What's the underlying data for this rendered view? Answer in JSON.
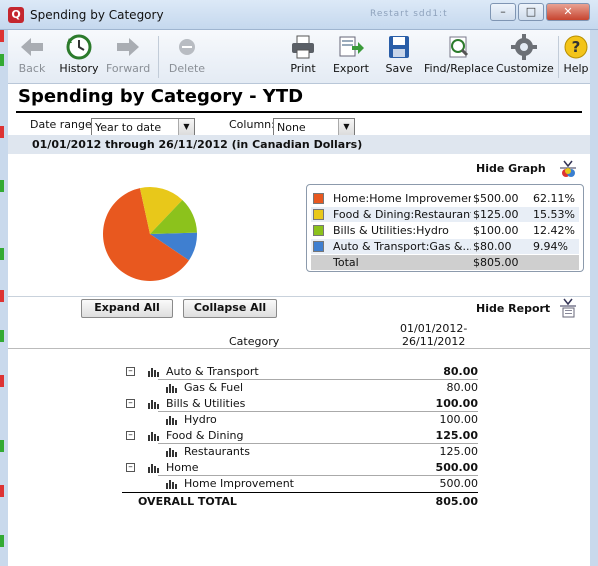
{
  "window": {
    "title": "Spending by Category",
    "icon_letter": "Q",
    "ghost_text": "Restart  sdd1:t"
  },
  "toolbar": {
    "items": [
      {
        "label": "Back",
        "icon": "back-arrow-icon",
        "enabled": false
      },
      {
        "label": "History",
        "icon": "history-clock-icon",
        "enabled": true
      },
      {
        "label": "Forward",
        "icon": "forward-arrow-icon",
        "enabled": false
      },
      {
        "label": "Delete",
        "icon": "delete-icon",
        "enabled": false
      },
      {
        "label": "Print",
        "icon": "printer-icon",
        "enabled": true
      },
      {
        "label": "Export",
        "icon": "export-icon",
        "enabled": true
      },
      {
        "label": "Save",
        "icon": "floppy-disk-icon",
        "enabled": true
      },
      {
        "label": "Find/Replace",
        "icon": "find-replace-icon",
        "enabled": true
      },
      {
        "label": "Customize",
        "icon": "gear-icon",
        "enabled": true
      },
      {
        "label": "Help",
        "icon": "help-icon",
        "enabled": true
      }
    ]
  },
  "report": {
    "title": "Spending by Category - YTD",
    "date_range_label": "Date range:",
    "date_range_value": "Year to date",
    "column_label": "Column:",
    "column_value": "None",
    "period_text": "01/01/2012 through 26/11/2012 (in Canadian Dollars)"
  },
  "graph": {
    "hide_label": "Hide Graph",
    "legend": [
      {
        "name": "Home:Home Improvement",
        "amount": "$500.00",
        "percent": "62.11%",
        "color": "#e8581f"
      },
      {
        "name": "Food & Dining:Restaurants",
        "amount": "$125.00",
        "percent": "15.53%",
        "color": "#e8c81a"
      },
      {
        "name": "Bills & Utilities:Hydro",
        "amount": "$100.00",
        "percent": "12.42%",
        "color": "#8cc21c"
      },
      {
        "name": "Auto & Transport:Gas &...",
        "amount": "$80.00",
        "percent": "9.94%",
        "color": "#3f7fd0"
      }
    ],
    "total_label": "Total",
    "total_amount": "$805.00"
  },
  "chart_data": {
    "type": "pie",
    "categories": [
      "Home:Home Improvement",
      "Food & Dining:Restaurants",
      "Bills & Utilities:Hydro",
      "Auto & Transport:Gas &..."
    ],
    "values": [
      500,
      125,
      100,
      80
    ],
    "colors": [
      "#e8581f",
      "#e8c81a",
      "#8cc21c",
      "#3f7fd0"
    ]
  },
  "report_table": {
    "expand_all": "Expand All",
    "collapse_all": "Collapse All",
    "hide_label": "Hide Report",
    "col_category": "Category",
    "col_period_line1": "01/01/2012-",
    "col_period_line2": "26/11/2012",
    "rows": [
      {
        "name": "Auto & Transport",
        "value": "80.00",
        "level": 0
      },
      {
        "name": "Gas & Fuel",
        "value": "80.00",
        "level": 1
      },
      {
        "name": "Bills & Utilities",
        "value": "100.00",
        "level": 0
      },
      {
        "name": "Hydro",
        "value": "100.00",
        "level": 1
      },
      {
        "name": "Food & Dining",
        "value": "125.00",
        "level": 0
      },
      {
        "name": "Restaurants",
        "value": "125.00",
        "level": 1
      },
      {
        "name": "Home",
        "value": "500.00",
        "level": 0
      },
      {
        "name": "Home Improvement",
        "value": "500.00",
        "level": 1
      }
    ],
    "overall_label": "OVERALL TOTAL",
    "overall_value": "805.00"
  }
}
